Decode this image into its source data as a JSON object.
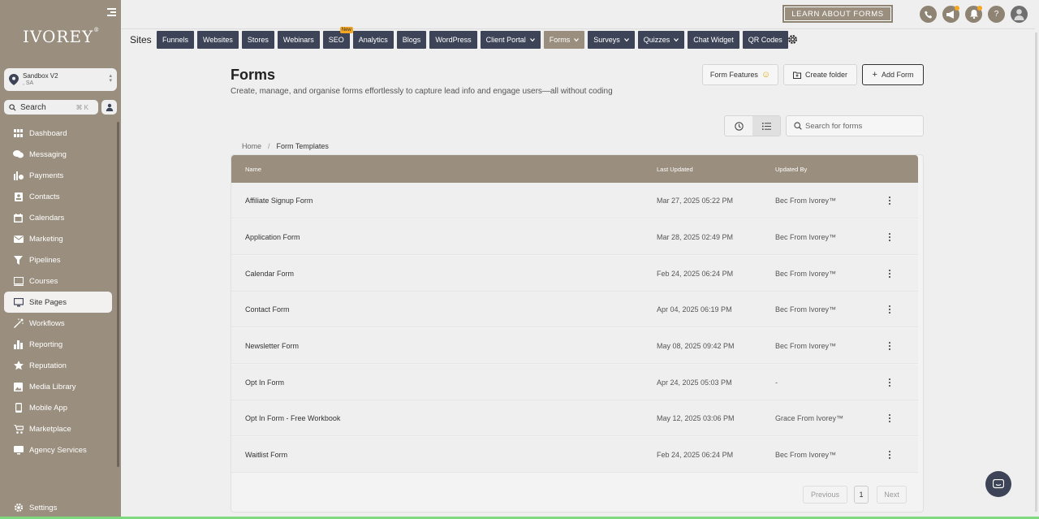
{
  "sidebar": {
    "logo": "IVOREY",
    "logo_mark": "®",
    "account": {
      "name": "Sandbox V2",
      "sub": ", SA"
    },
    "search": {
      "label": "Search",
      "shortcut": "⌘ K"
    },
    "items": [
      {
        "label": "Dashboard",
        "icon": "grid-icon"
      },
      {
        "label": "Messaging",
        "icon": "chat-icon"
      },
      {
        "label": "Payments",
        "icon": "payments-icon"
      },
      {
        "label": "Contacts",
        "icon": "contacts-icon"
      },
      {
        "label": "Calendars",
        "icon": "calendar-icon"
      },
      {
        "label": "Marketing",
        "icon": "mail-icon"
      },
      {
        "label": "Pipelines",
        "icon": "funnel-icon"
      },
      {
        "label": "Courses",
        "icon": "courses-icon"
      },
      {
        "label": "Site Pages",
        "icon": "monitor-icon",
        "active": true
      },
      {
        "label": "Workflows",
        "icon": "wand-icon"
      },
      {
        "label": "Reporting",
        "icon": "bar-chart-icon"
      },
      {
        "label": "Reputation",
        "icon": "star-icon"
      },
      {
        "label": "Media Library",
        "icon": "image-icon"
      },
      {
        "label": "Mobile App",
        "icon": "mobile-icon"
      },
      {
        "label": "Marketplace",
        "icon": "cart-icon"
      },
      {
        "label": "Agency Services",
        "icon": "desktop-icon"
      }
    ],
    "settings": "Settings"
  },
  "topbar": {
    "learn": "LEARN ABOUT FORMS",
    "help": "?"
  },
  "tabs": {
    "section": "Sites",
    "items": [
      "Funnels",
      "Websites",
      "Stores",
      "Webinars",
      "SEO",
      "Analytics",
      "Blogs",
      "WordPress",
      "Client Portal",
      "Forms",
      "Surveys",
      "Quizzes",
      "Chat Widget",
      "QR Codes"
    ],
    "new_badge": "New"
  },
  "main": {
    "title": "Forms",
    "description": "Create, manage, and organise forms effortlessly to capture lead info and engage users—all without coding",
    "buttons": {
      "features": "Form Features",
      "create_folder": "Create folder",
      "add_form": "Add Form"
    },
    "search_placeholder": "Search for forms",
    "breadcrumb": {
      "home": "Home",
      "sep": "/",
      "current": "Form Templates"
    },
    "table": {
      "headers": {
        "name": "Name",
        "updated": "Last Updated",
        "by": "Updated By"
      },
      "rows": [
        {
          "name": "Affiliate Signup Form",
          "updated": "Mar 27, 2025 05:22 PM",
          "by": "Bec From Ivorey™"
        },
        {
          "name": "Application Form",
          "updated": "Mar 28, 2025 02:49 PM",
          "by": "Bec From Ivorey™"
        },
        {
          "name": "Calendar Form",
          "updated": "Feb 24, 2025 06:24 PM",
          "by": "Bec From Ivorey™"
        },
        {
          "name": "Contact Form",
          "updated": "Apr 04, 2025 06:19 PM",
          "by": "Bec From Ivorey™"
        },
        {
          "name": "Newsletter Form",
          "updated": "May 08, 2025 09:42 PM",
          "by": "Bec From Ivorey™"
        },
        {
          "name": "Opt In Form",
          "updated": "Apr 24, 2025 05:03 PM",
          "by": "-"
        },
        {
          "name": "Opt In Form - Free Workbook",
          "updated": "May 12, 2025 03:06 PM",
          "by": "Grace From Ivorey™"
        },
        {
          "name": "Waitlist Form",
          "updated": "Feb 24, 2025 06:24 PM",
          "by": "Bec From Ivorey™"
        }
      ]
    },
    "pagination": {
      "prev": "Previous",
      "page": "1",
      "next": "Next"
    }
  },
  "colors": {
    "sidebar": "#9a8e7e",
    "tab": "#3d4458",
    "accent": "#9a8e7e"
  }
}
